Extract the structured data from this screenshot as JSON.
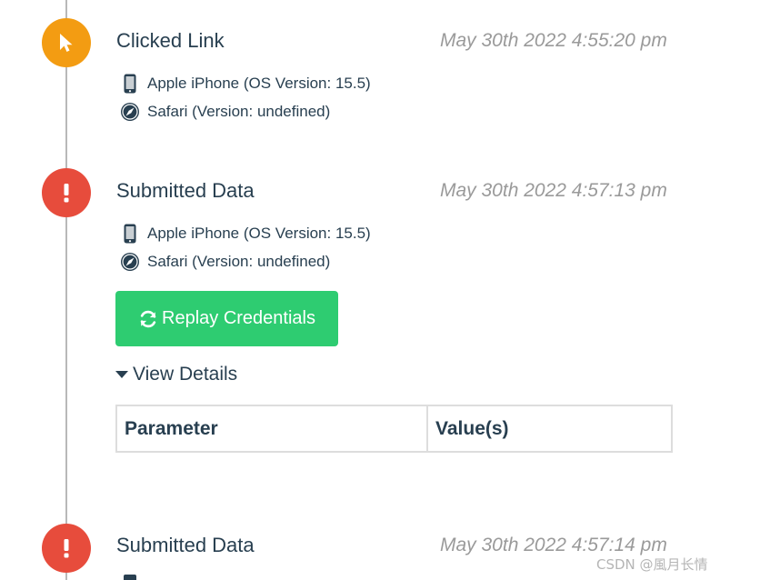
{
  "events": [
    {
      "type": "clicked",
      "title": "Clicked Link",
      "timestamp": "May 30th 2022 4:55:20 pm",
      "device": "Apple iPhone (OS Version: 15.5)",
      "browser": "Safari (Version: undefined)",
      "icon": "cursor-icon",
      "color": "#f39c12"
    },
    {
      "type": "submitted",
      "title": "Submitted Data",
      "timestamp": "May 30th 2022 4:57:13 pm",
      "device": "Apple iPhone (OS Version: 15.5)",
      "browser": "Safari (Version: undefined)",
      "icon": "exclamation-icon",
      "color": "#e74c3c",
      "replay_label": "Replay Credentials",
      "view_details_label": "View Details",
      "table_headers": [
        "Parameter",
        "Value(s)"
      ]
    },
    {
      "type": "submitted",
      "title": "Submitted Data",
      "timestamp": "May 30th 2022 4:57:14 pm",
      "icon": "exclamation-icon",
      "color": "#e74c3c"
    }
  ],
  "watermark": "CSDN @風月长情",
  "colors": {
    "success": "#2ecc71",
    "warning": "#f39c12",
    "danger": "#e74c3c",
    "text": "#283f50",
    "muted": "#9a9a9a"
  }
}
